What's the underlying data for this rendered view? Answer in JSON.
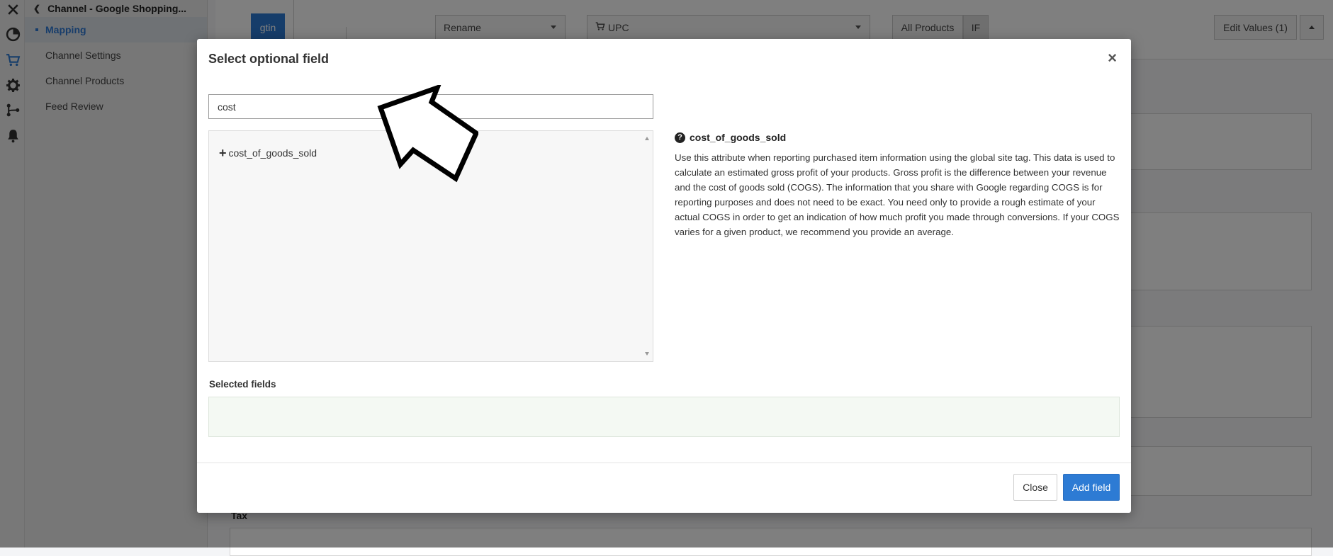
{
  "sidebar": {
    "title": "Channel - Google Shopping...",
    "items": [
      {
        "label": "Mapping",
        "active": true
      },
      {
        "label": "Channel Settings"
      },
      {
        "label": "Channel Products"
      },
      {
        "label": "Feed Review"
      }
    ],
    "icons": [
      "close-icon",
      "pie-chart-icon",
      "cart-icon",
      "gear-icon",
      "workflow-icon",
      "bell-icon"
    ]
  },
  "background": {
    "field_tag": "gtin",
    "action_select": "Rename",
    "source_select": "UPC",
    "scope_button": "All Products",
    "if_button": "IF",
    "edit_values_button": "Edit Values (1)",
    "section_label": "Tax"
  },
  "modal": {
    "title": "Select optional field",
    "search": {
      "value": "cost",
      "placeholder": ""
    },
    "results": [
      {
        "label": "cost_of_goods_sold"
      }
    ],
    "info": {
      "field": "cost_of_goods_sold",
      "description": "Use this attribute when reporting purchased item information using the global site tag. This data is used to calculate an estimated gross profit of your products. Gross profit is the difference between your revenue and the cost of goods sold (COGS). The information that you share with Google regarding COGS is for reporting purposes and does not need to be exact. You need only to provide a rough estimate of your actual COGS in order to get an indication of how much profit you made through conversions. If your COGS varies for a given product, we recommend you provide an average."
    },
    "selected_label": "Selected fields",
    "close_label": "Close",
    "add_label": "Add field"
  },
  "colors": {
    "accent": "#2d7bd4",
    "selected_bg": "#f4f9f3"
  }
}
